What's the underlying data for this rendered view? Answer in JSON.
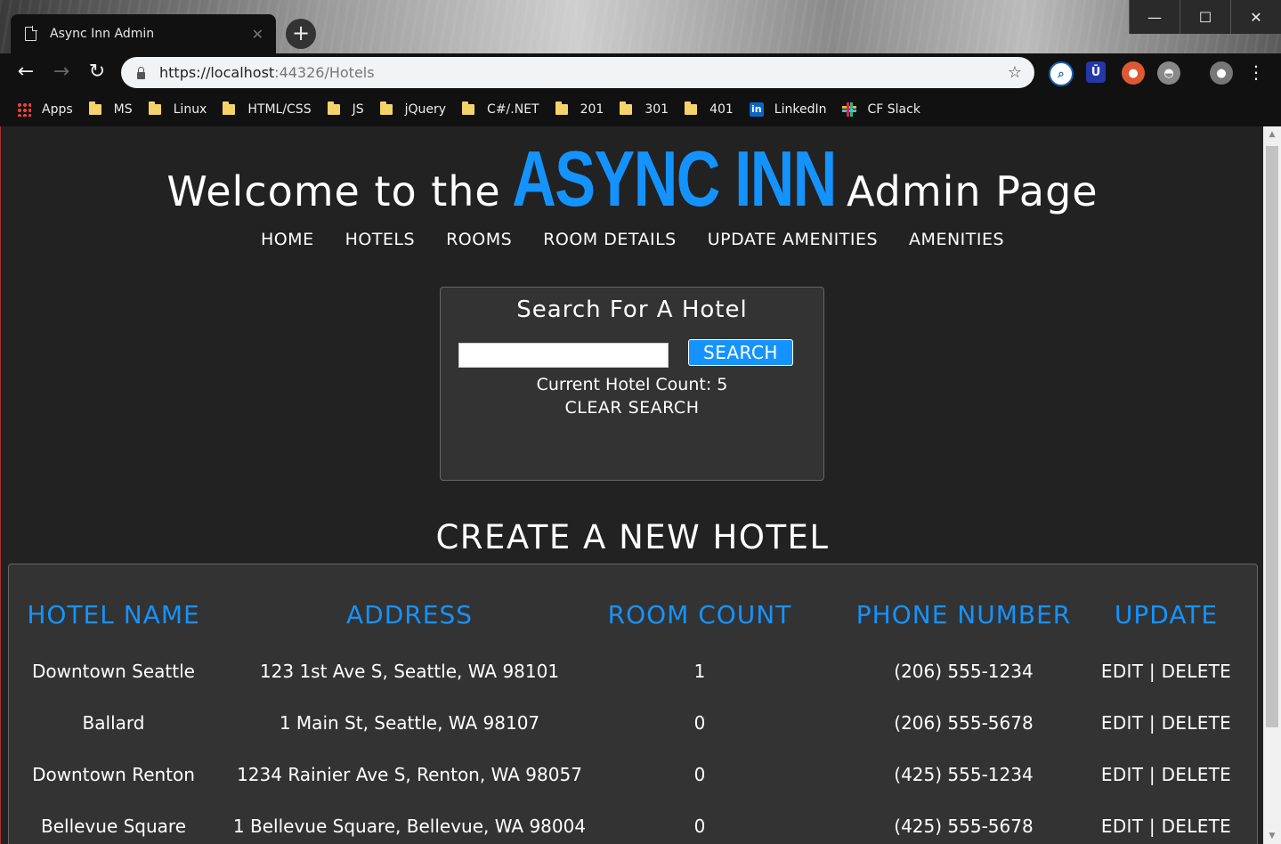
{
  "browser": {
    "tab_title": "Async Inn Admin",
    "url_host": "https://localhost",
    "url_path": ":44326/Hotels",
    "bookmarks": [
      "Apps",
      "MS",
      "Linux",
      "HTML/CSS",
      "JS",
      "jQuery",
      "C#/.NET",
      "201",
      "301",
      "401",
      "LinkedIn",
      "CF Slack"
    ]
  },
  "header": {
    "welcome_prefix": "Welcome to the",
    "brand": "ASYNC INN",
    "welcome_suffix": "Admin Page"
  },
  "nav": [
    "HOME",
    "HOTELS",
    "ROOMS",
    "ROOM DETAILS",
    "UPDATE AMENITIES",
    "AMENITIES"
  ],
  "search": {
    "title": "Search For A Hotel",
    "input_value": "",
    "button_label": "SEARCH",
    "count_text": "Current Hotel Count: 5",
    "clear_label": "CLEAR SEARCH"
  },
  "create_label": "CREATE A NEW HOTEL",
  "table": {
    "headers": [
      "HOTEL NAME",
      "ADDRESS",
      "ROOM COUNT",
      "PHONE NUMBER",
      "UPDATE"
    ],
    "rows": [
      {
        "name": "Downtown Seattle",
        "address": "123 1st Ave S, Seattle, WA 98101",
        "rooms": "1",
        "phone": "(206) 555-1234",
        "update": "EDIT | DELETE"
      },
      {
        "name": "Ballard",
        "address": "1 Main St, Seattle, WA 98107",
        "rooms": "0",
        "phone": "(206) 555-5678",
        "update": "EDIT | DELETE"
      },
      {
        "name": "Downtown Renton",
        "address": "1234 Rainier Ave S, Renton, WA 98057",
        "rooms": "0",
        "phone": "(425) 555-1234",
        "update": "EDIT | DELETE"
      },
      {
        "name": "Bellevue Square",
        "address": "1 Bellevue Square, Bellevue, WA 98004",
        "rooms": "0",
        "phone": "(425) 555-5678",
        "update": "EDIT | DELETE"
      }
    ]
  },
  "colors": {
    "accent": "#1493ff",
    "background": "#222222",
    "panel": "#333333"
  }
}
